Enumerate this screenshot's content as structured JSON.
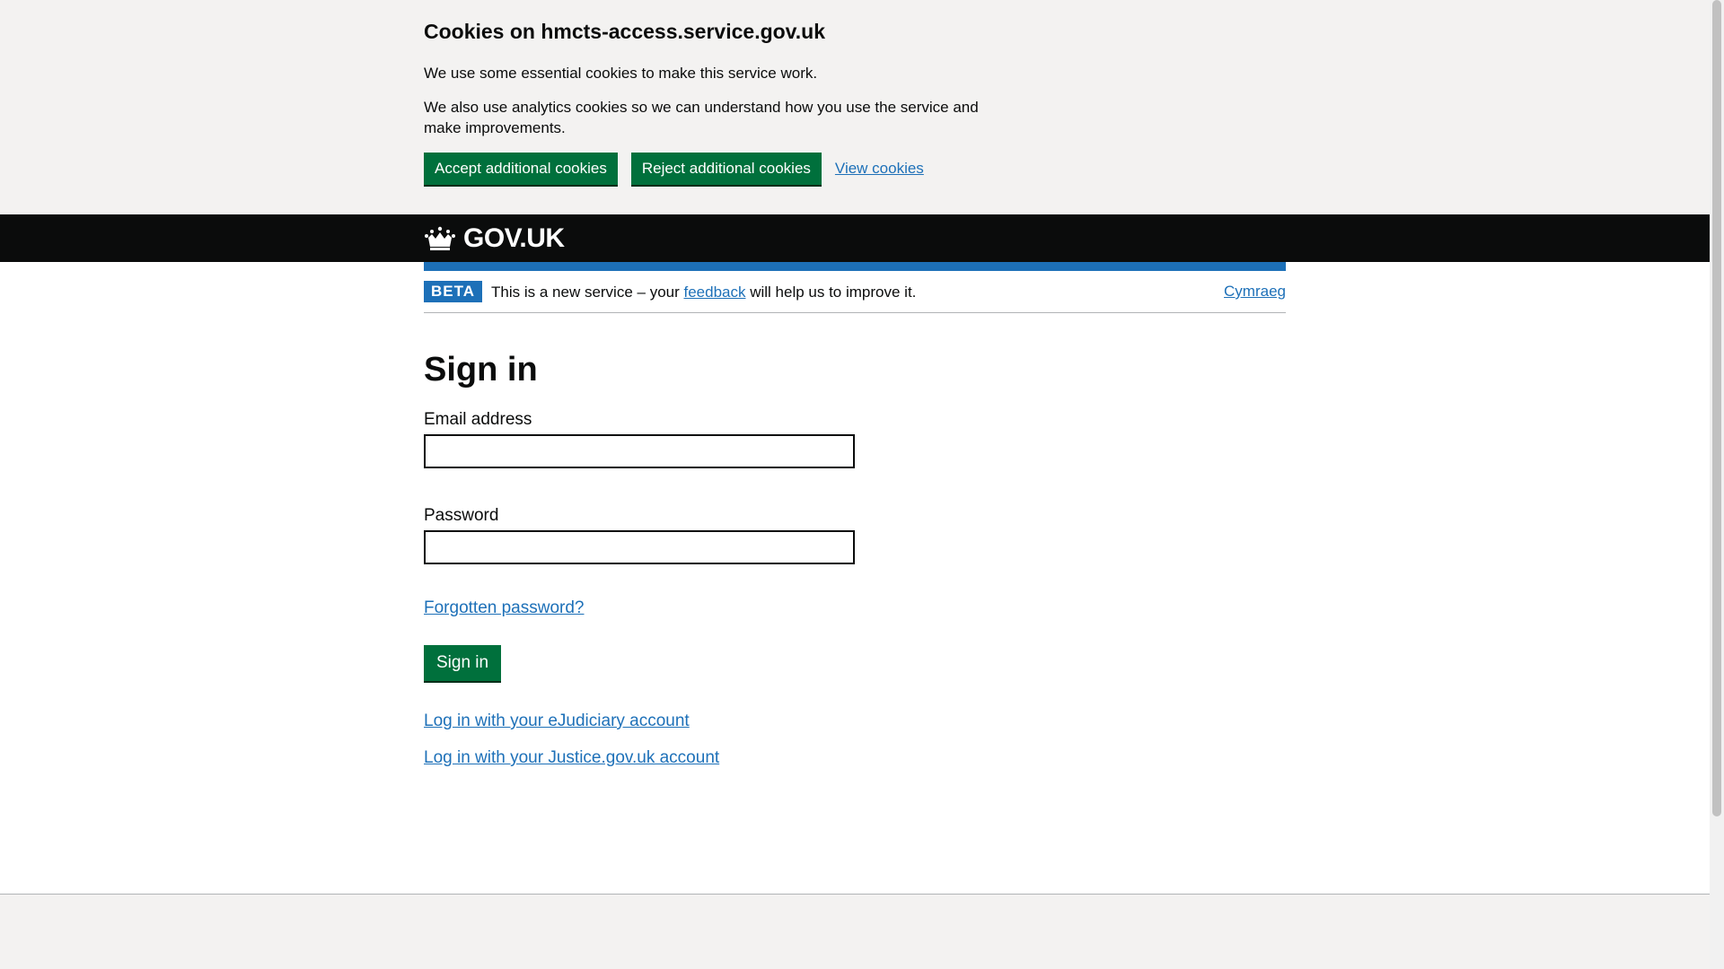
{
  "cookie_banner": {
    "heading": "Cookies on hmcts-access.service.gov.uk",
    "text_essential": "We use some essential cookies to make this service work.",
    "text_analytics": "We also use analytics cookies so we can understand how you use the service and make improvements.",
    "accept_label": "Accept additional cookies",
    "reject_label": "Reject additional cookies",
    "view_label": "View cookies"
  },
  "header": {
    "logo_text": "GOV.UK"
  },
  "phase_banner": {
    "tag": "BETA",
    "text_before": "This is a new service – your ",
    "feedback_link": "feedback",
    "text_after": " will help us to improve it.",
    "language_link": "Cymraeg"
  },
  "main": {
    "title": "Sign in",
    "email_label": "Email address",
    "email_value": "",
    "password_label": "Password",
    "password_value": "",
    "forgot_link": "Forgotten password?",
    "sign_in_button": "Sign in",
    "ejudiciary_link": "Log in with your eJudiciary account",
    "justice_link": "Log in with your Justice.gov.uk account"
  },
  "colors": {
    "button_green": "#00703c",
    "link_blue": "#1d70b8",
    "header_black": "#0b0c0c",
    "banner_grey": "#f3f2f1"
  },
  "icons": {
    "logo": "crown-icon"
  }
}
